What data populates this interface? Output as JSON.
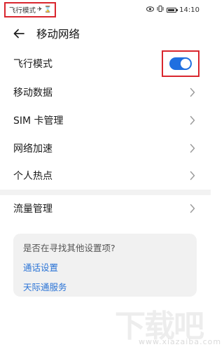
{
  "status_bar": {
    "carrier_text": "飞行模式",
    "time": "14:10"
  },
  "header": {
    "title": "移动网络"
  },
  "settings": {
    "airplane_mode": {
      "label": "飞行模式",
      "enabled": true
    },
    "items": [
      {
        "label": "移动数据"
      },
      {
        "label": "SIM 卡管理"
      },
      {
        "label": "网络加速"
      },
      {
        "label": "个人热点"
      },
      {
        "label": "流量管理"
      }
    ]
  },
  "suggestion_card": {
    "question": "是否在寻找其他设置项?",
    "links": [
      "通话设置",
      "天际通服务"
    ]
  },
  "watermark": {
    "big": "下载吧",
    "small": "www.xiazaiba.com"
  },
  "colors": {
    "accent": "#1f6fe0",
    "link": "#2a73d6",
    "highlight_box": "#d9262e"
  },
  "icons": {
    "airplane": "airplane-icon",
    "hourglass": "hourglass-icon",
    "back": "back-arrow-icon",
    "chevron": "chevron-right-icon"
  }
}
